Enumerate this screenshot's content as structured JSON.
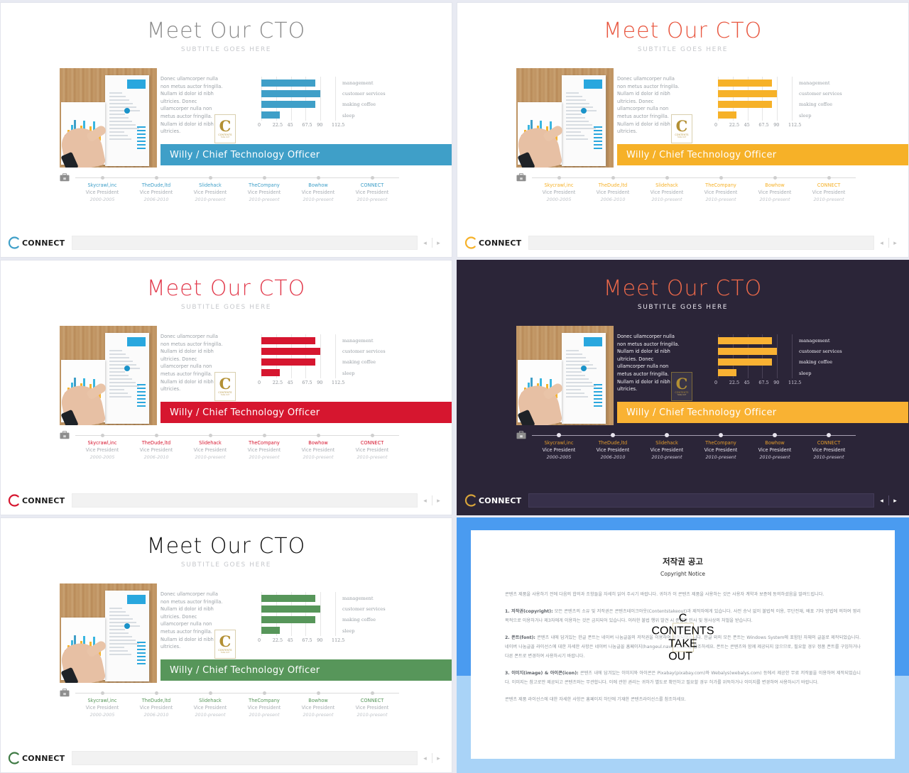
{
  "slide": {
    "title": "Meet Our CTO",
    "subtitle": "SUBTITLE GOES HERE",
    "body_text": "Donec ullamcorper nulla non metus auctor fringilla. Nullam id dolor id nibh ultricies. Donec ullamcorper nulla non metus auctor fringilla. Nullam id dolor id nibh ultricies.",
    "name_bar": "Willy / Chief Technology Officer",
    "watermark": {
      "letter": "C",
      "line1": "CONTENTS",
      "line2": "TAKE OUT"
    },
    "footer": {
      "logo_text": "CONNECT",
      "prev": "◂",
      "next": "▸"
    }
  },
  "chart_data": {
    "type": "bar",
    "orientation": "horizontal",
    "categories": [
      "management",
      "customer services",
      "making coffee",
      "sleep"
    ],
    "values": [
      82,
      90,
      82,
      28
    ],
    "title": "",
    "xlabel": "",
    "ylabel": "",
    "xlim": [
      0,
      112.5
    ],
    "xticks": [
      "0",
      "22.5",
      "45",
      "67.5",
      "90",
      "112.5"
    ],
    "grid": true,
    "legend_position": "right"
  },
  "timeline": [
    {
      "company": "Skycrawl,inc",
      "role": "Vice President",
      "years": "2000-2005"
    },
    {
      "company": "TheDude,ltd",
      "role": "Vice President",
      "years": "2006-2010"
    },
    {
      "company": "Slidehack",
      "role": "Vice President",
      "years": "2010-present"
    },
    {
      "company": "TheCompany",
      "role": "Vice President",
      "years": "2010-present"
    },
    {
      "company": "Bowhow",
      "role": "Vice President",
      "years": "2010-present"
    },
    {
      "company": "CONNECT",
      "role": "Vice President",
      "years": "2010-present"
    }
  ],
  "themes": [
    {
      "id": "blue",
      "accent": "#3f9fc8",
      "title_color": "#8c8c8c",
      "company_color": "#3f9fc8",
      "logo_color": "#3f9fc8",
      "bg": "#ffffff"
    },
    {
      "id": "amber",
      "accent": "#f6b128",
      "title_color": "#e8563f",
      "company_color": "#f6b128",
      "logo_color": "#f6b128",
      "bg": "#ffffff"
    },
    {
      "id": "red",
      "accent": "#d6162f",
      "title_color": "#e23b4d",
      "company_color": "#d6162f",
      "logo_color": "#d6162f",
      "bg": "#ffffff"
    },
    {
      "id": "dark-amber",
      "accent": "#f9b233",
      "title_color": "#ef6a4a",
      "company_color": "#e09a2c",
      "logo_color": "#d8a43a",
      "bg": "#2b2538"
    },
    {
      "id": "green",
      "accent": "#57965a",
      "title_color": "#111111",
      "company_color": "#57965a",
      "logo_color": "#3f7a44",
      "bg": "#ffffff"
    }
  ],
  "copyright": {
    "title": "저작권 공고",
    "subtitle": "Copyright Notice",
    "intro": "콘텐츠 제품을 사용하기 전에 다음의 합의과 조항들을 자세히 읽어 주시기 바랍니다. 귀하가 이 콘텐츠 제품을 사용하는 것은 사용자 계약과 보증에 동의하셨음을 말려드립니다.",
    "p1_label": "1. 저작권(copyright):",
    "p1": "모든 콘텐츠의 소유 및 저작권은 콘텐츠테이크아웃(Contentstakeout)과 제작자에게 있습니다. 사전 승낙 없이 불법적 이용, 무단전재, 배포 기타 방법에 의하여 영리 목적으로 이용하거나 제3자에게 이용하는 것은 금지되어 있습니다. 이러한 불법 행위 발견 시 준엄한 민사 및 형사상의 처벌을 받습니다.",
    "p2_label": "2. 폰트(font):",
    "p2": "콘텐츠 내에 담겨있는 한글 폰트는 네이버 나눔글꼴의 저작권을 이용하여 제작되었습니다. 한글 외의 모든 폰트는 Windows System에 포함된 자체의 글꼴로 제작되었습니다. 네이버 나눔글꼴 라이선스에 대한 자세한 사항은 네이버 나눔글꼴 홈페이지(hangeul.naver.com)를 참조하세요. 폰트는 콘텐츠와 함께 제공되지 않으므로, 필요할 경우 정품 폰트를 구입하거나 다른 폰트로 변경하여 사용하시기 바랍니다.",
    "p3_label": "3. 이미지(image) & 아이콘(icon):",
    "p3": "콘텐츠 내에 담겨있는 이미지와 아이콘은 Pixabay(pixabay.com)와 Webalys(webalys.com) 등에서 제공한 무료 저작물을 이용하여 제작되었습니다. 이미지는 참고로만 제공되고 콘텐츠와는 무관합니다. 이에 관한 권리는 귀하가 별도로 확인하고 필요할 경우 허가를 위득하거나 이미지를 변경하여 사용하시기 바랍니다.",
    "outro": "콘텐츠 제품 라이선스에 대한 자세한 사항은 홈페이지 하단에 기재한 콘텐츠라이선스를 참조하세요.",
    "bg_top": "#4a9bf0",
    "bg_bottom": "#a9d3f7",
    "watermark": {
      "letter": "C",
      "line1": "CONTENTS",
      "line2": "TAKE OUT"
    }
  }
}
